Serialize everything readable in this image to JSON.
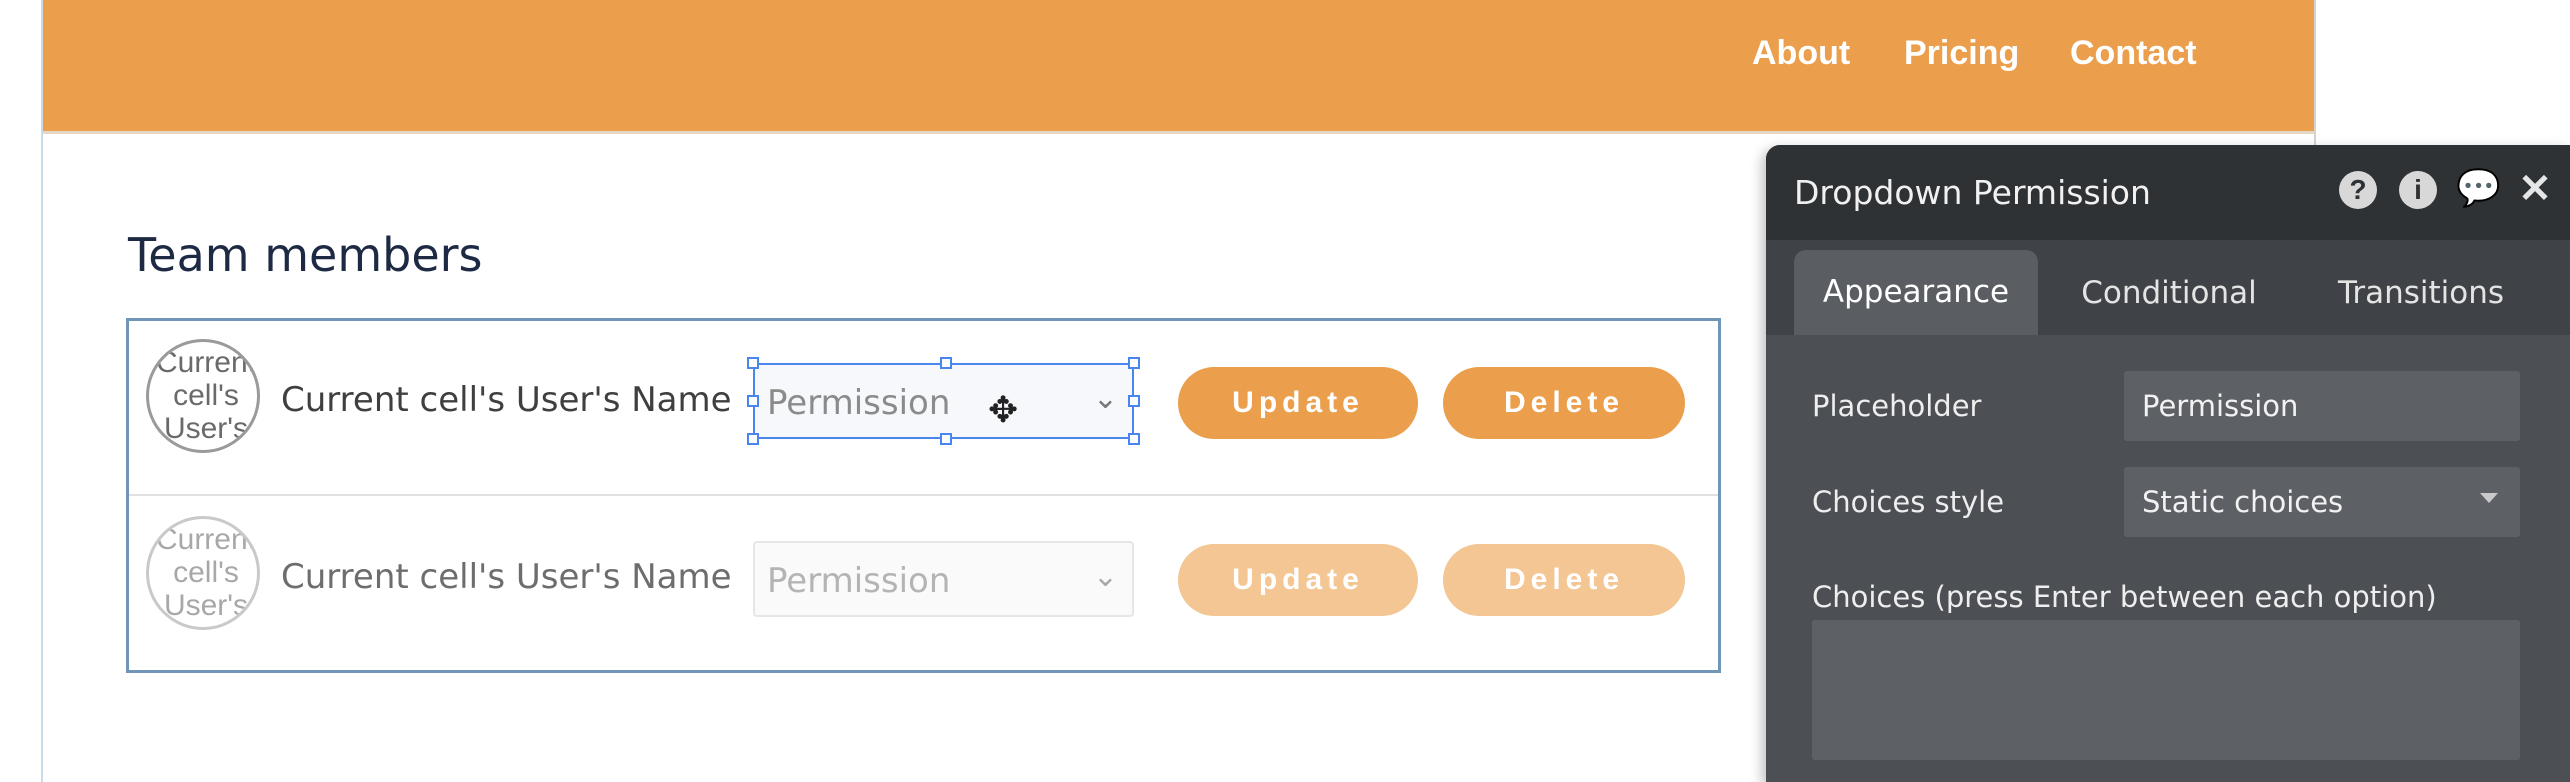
{
  "header": {
    "nav": [
      "About",
      "Pricing",
      "Contact"
    ]
  },
  "page": {
    "title": "Team members"
  },
  "rows": [
    {
      "avatar_text": "Current cell's User's",
      "name": "Current cell's User's Name",
      "dropdown_placeholder": "Permission",
      "update_label": "Update",
      "delete_label": "Delete"
    },
    {
      "avatar_text": "Current cell's User's",
      "name": "Current cell's User's Name",
      "dropdown_placeholder": "Permission",
      "update_label": "Update",
      "delete_label": "Delete"
    }
  ],
  "editor": {
    "title": "Dropdown Permission",
    "icons": [
      "help-icon",
      "info-icon",
      "comment-icon",
      "close-icon"
    ],
    "tabs": [
      "Appearance",
      "Conditional",
      "Transitions"
    ],
    "active_tab": "Appearance",
    "fields": {
      "placeholder_label": "Placeholder",
      "placeholder_value": "Permission",
      "choices_style_label": "Choices style",
      "choices_style_value": "Static choices",
      "choices_label": "Choices (press Enter between each option)",
      "choices_value": ""
    }
  },
  "colors": {
    "header": "#eb9e4b",
    "button": "#eb9e4b",
    "button_faded": "#f3c693",
    "selection": "#4a86f0",
    "editor_bg": "#4c4f54",
    "editor_head": "#2f3234"
  }
}
